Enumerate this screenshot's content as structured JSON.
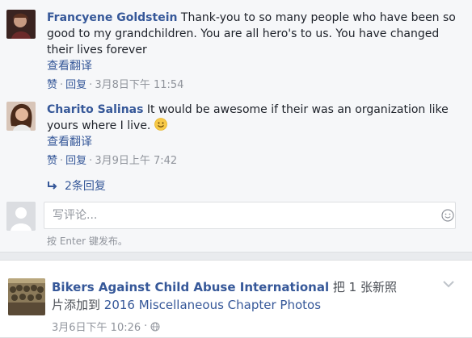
{
  "comments": [
    {
      "author": "Francyene Goldstein",
      "text": "Thank-you to so many people who have been so good to my grandchildren. You are all hero's to us. You have changed their lives forever",
      "see_translation": "查看翻译",
      "like_label": "赞",
      "reply_label": "回复",
      "timestamp": "3月8日下午 11:54"
    },
    {
      "author": "Charito Salinas",
      "text": "It would be awesome if their was an organization like yours where I live.",
      "see_translation": "查看翻译",
      "like_label": "赞",
      "reply_label": "回复",
      "timestamp": "3月9日上午 7:42"
    }
  ],
  "replies_link": "2条回复",
  "reply_box": {
    "placeholder": "写评论...",
    "hint": "按 Enter 键发布。"
  },
  "post": {
    "page_name": "Bikers Against Child Abuse International",
    "action_text_1": "把 1 张新照片添加到",
    "album": "2016 Miscellaneous Chapter Photos",
    "timestamp": "3月6日下午 10:26",
    "audience_icon": "globe-icon"
  },
  "colors": {
    "link": "#365899",
    "muted": "#90949c",
    "background": "#e9ebee"
  }
}
